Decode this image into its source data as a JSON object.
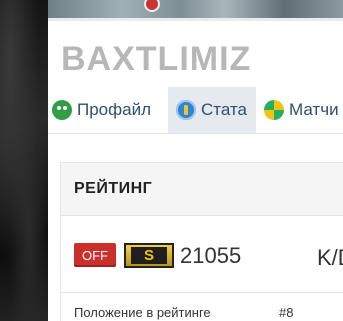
{
  "profile": {
    "username": "BAXTLIMIZ"
  },
  "tabs": [
    {
      "label": "Профайл",
      "icon": "profile-icon",
      "active": false
    },
    {
      "label": "Стата",
      "icon": "stats-icon",
      "active": true
    },
    {
      "label": "Матчи",
      "icon": "matches-icon",
      "active": false
    }
  ],
  "rating": {
    "title": "РЕЙТИНГ",
    "status_badge": "OFF",
    "rank_letter": "S",
    "value": "21055",
    "kd_label": "K/D",
    "position_label": "Положение в рейтинге",
    "position_value": "#8"
  },
  "colors": {
    "off_badge": "#c9302c",
    "rank_badge": "#d4af37",
    "tab_text": "#2f4f6f",
    "username": "#b7b7b7"
  }
}
